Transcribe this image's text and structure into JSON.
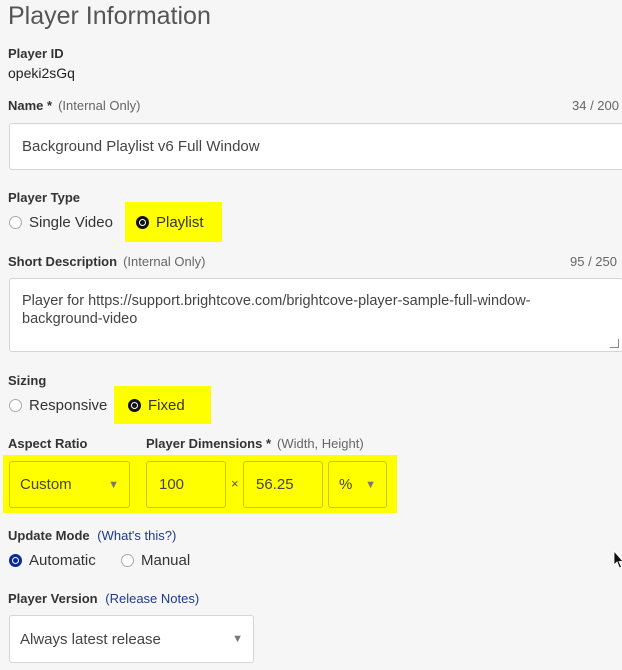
{
  "header": {
    "title": "Player Information"
  },
  "player_id": {
    "label": "Player ID",
    "value": "opeki2sGq"
  },
  "name": {
    "label": "Name *",
    "note": "(Internal Only)",
    "counter": "34 / 200",
    "value": "Background Playlist v6 Full Window"
  },
  "player_type": {
    "label": "Player Type",
    "options": [
      "Single Video",
      "Playlist"
    ],
    "selected": "Playlist"
  },
  "short_description": {
    "label": "Short Description",
    "note": "(Internal Only)",
    "counter": "95 / 250",
    "line1": "Player for https://support.brightcove.com/brightcove-player-sample-full-window-",
    "line2": "background-video"
  },
  "sizing": {
    "label": "Sizing",
    "options": [
      "Responsive",
      "Fixed"
    ],
    "selected": "Fixed"
  },
  "aspect_ratio": {
    "label": "Aspect Ratio",
    "value": "Custom"
  },
  "player_dimensions": {
    "label": "Player Dimensions *",
    "note": "(Width, Height)",
    "width": "100",
    "separator": "×",
    "height": "56.25",
    "unit": "%"
  },
  "update_mode": {
    "label": "Update Mode",
    "help_open": "(",
    "help_link": "What's this?",
    "help_close": ")",
    "options": [
      "Automatic",
      "Manual"
    ],
    "selected": "Automatic"
  },
  "player_version": {
    "label": "Player Version",
    "notes_open": "(",
    "notes_link": "Release Notes",
    "notes_close": ")",
    "value": "Always latest release"
  },
  "colors": {
    "highlight": "#ffff00",
    "link": "#1b3b8a",
    "radio_selected_blue": "#0a2a9c"
  },
  "icons": {
    "dropdown": "caret-down-icon",
    "cursor": "mouse-pointer-icon"
  }
}
